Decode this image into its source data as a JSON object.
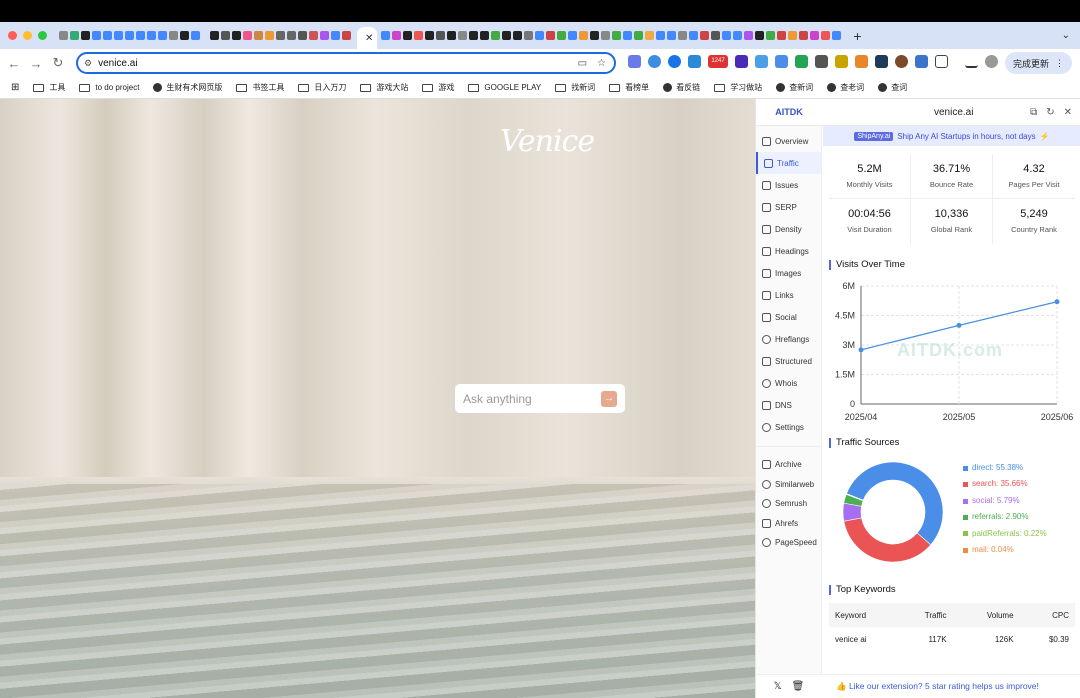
{
  "browser": {
    "active_tab_close": "✕",
    "new_tab": "+",
    "url": "venice.ai",
    "update_button": "完成更新",
    "badge": "1247",
    "bookmarks": [
      "工具",
      "to do project",
      "生财有术网页版",
      "书签工具",
      "日入万刀",
      "游戏大站",
      "游戏",
      "GOOGLE PLAY",
      "找新词",
      "看榜单",
      "看反链",
      "学习做站",
      "查新词",
      "查老词",
      "查词"
    ]
  },
  "page": {
    "logo": "Venice",
    "ask_placeholder": "Ask anything",
    "ask_button": "→"
  },
  "panel": {
    "brand": "AITDK",
    "domain": "venice.ai",
    "banner_tag": "ShipAny.ai",
    "banner_text": "Ship Any AI Startups in hours, not days",
    "nav": [
      "Overview",
      "Traffic",
      "Issues",
      "SERP",
      "Density",
      "Headings",
      "Images",
      "Links",
      "Social",
      "Hreflangs",
      "Structured",
      "Whois",
      "DNS",
      "Settings"
    ],
    "nav2": [
      "Archive",
      "Similarweb",
      "Semrush",
      "Ahrefs",
      "PageSpeed"
    ],
    "stats": [
      {
        "value": "5.2M",
        "label": "Monthly Visits"
      },
      {
        "value": "36.71%",
        "label": "Bounce Rate"
      },
      {
        "value": "4.32",
        "label": "Pages Per Visit"
      },
      {
        "value": "00:04:56",
        "label": "Visit Duration"
      },
      {
        "value": "10,336",
        "label": "Global Rank"
      },
      {
        "value": "5,249",
        "label": "Country Rank"
      }
    ],
    "visits_title": "Visits Over Time",
    "sources_title": "Traffic Sources",
    "keywords_title": "Top Keywords",
    "keywords_headers": [
      "Keyword",
      "Traffic",
      "Volume",
      "CPC"
    ],
    "keywords_rows": [
      [
        "venice ai",
        "117K",
        "126K",
        "$0.39"
      ]
    ],
    "footer": "👍 Like our extension? 5 star rating helps us improve!",
    "watermark": "AITDK.com"
  },
  "chart_data": [
    {
      "type": "line",
      "x": [
        "2025/04",
        "2025/05",
        "2025/06"
      ],
      "values": [
        2.75,
        4.0,
        5.2
      ],
      "ylim": [
        0,
        6
      ],
      "yticks": [
        "0",
        "1.5M",
        "3M",
        "4.5M",
        "6M"
      ],
      "color": "#4a90e2"
    },
    {
      "type": "pie",
      "donut": true,
      "slices": [
        {
          "label": "direct: 55.38%",
          "value": 55.38,
          "color": "#4a8ee8"
        },
        {
          "label": "search: 35.66%",
          "value": 35.66,
          "color": "#ea5455"
        },
        {
          "label": "social: 5.79%",
          "value": 5.79,
          "color": "#a66ef0"
        },
        {
          "label": "referrals: 2.90%",
          "value": 2.9,
          "color": "#4caf50"
        },
        {
          "label": "paidReferrals: 0.22%",
          "value": 0.22,
          "color": "#8bc34a"
        },
        {
          "label": "mail: 0.04%",
          "value": 0.04,
          "color": "#f08a45"
        }
      ]
    }
  ]
}
